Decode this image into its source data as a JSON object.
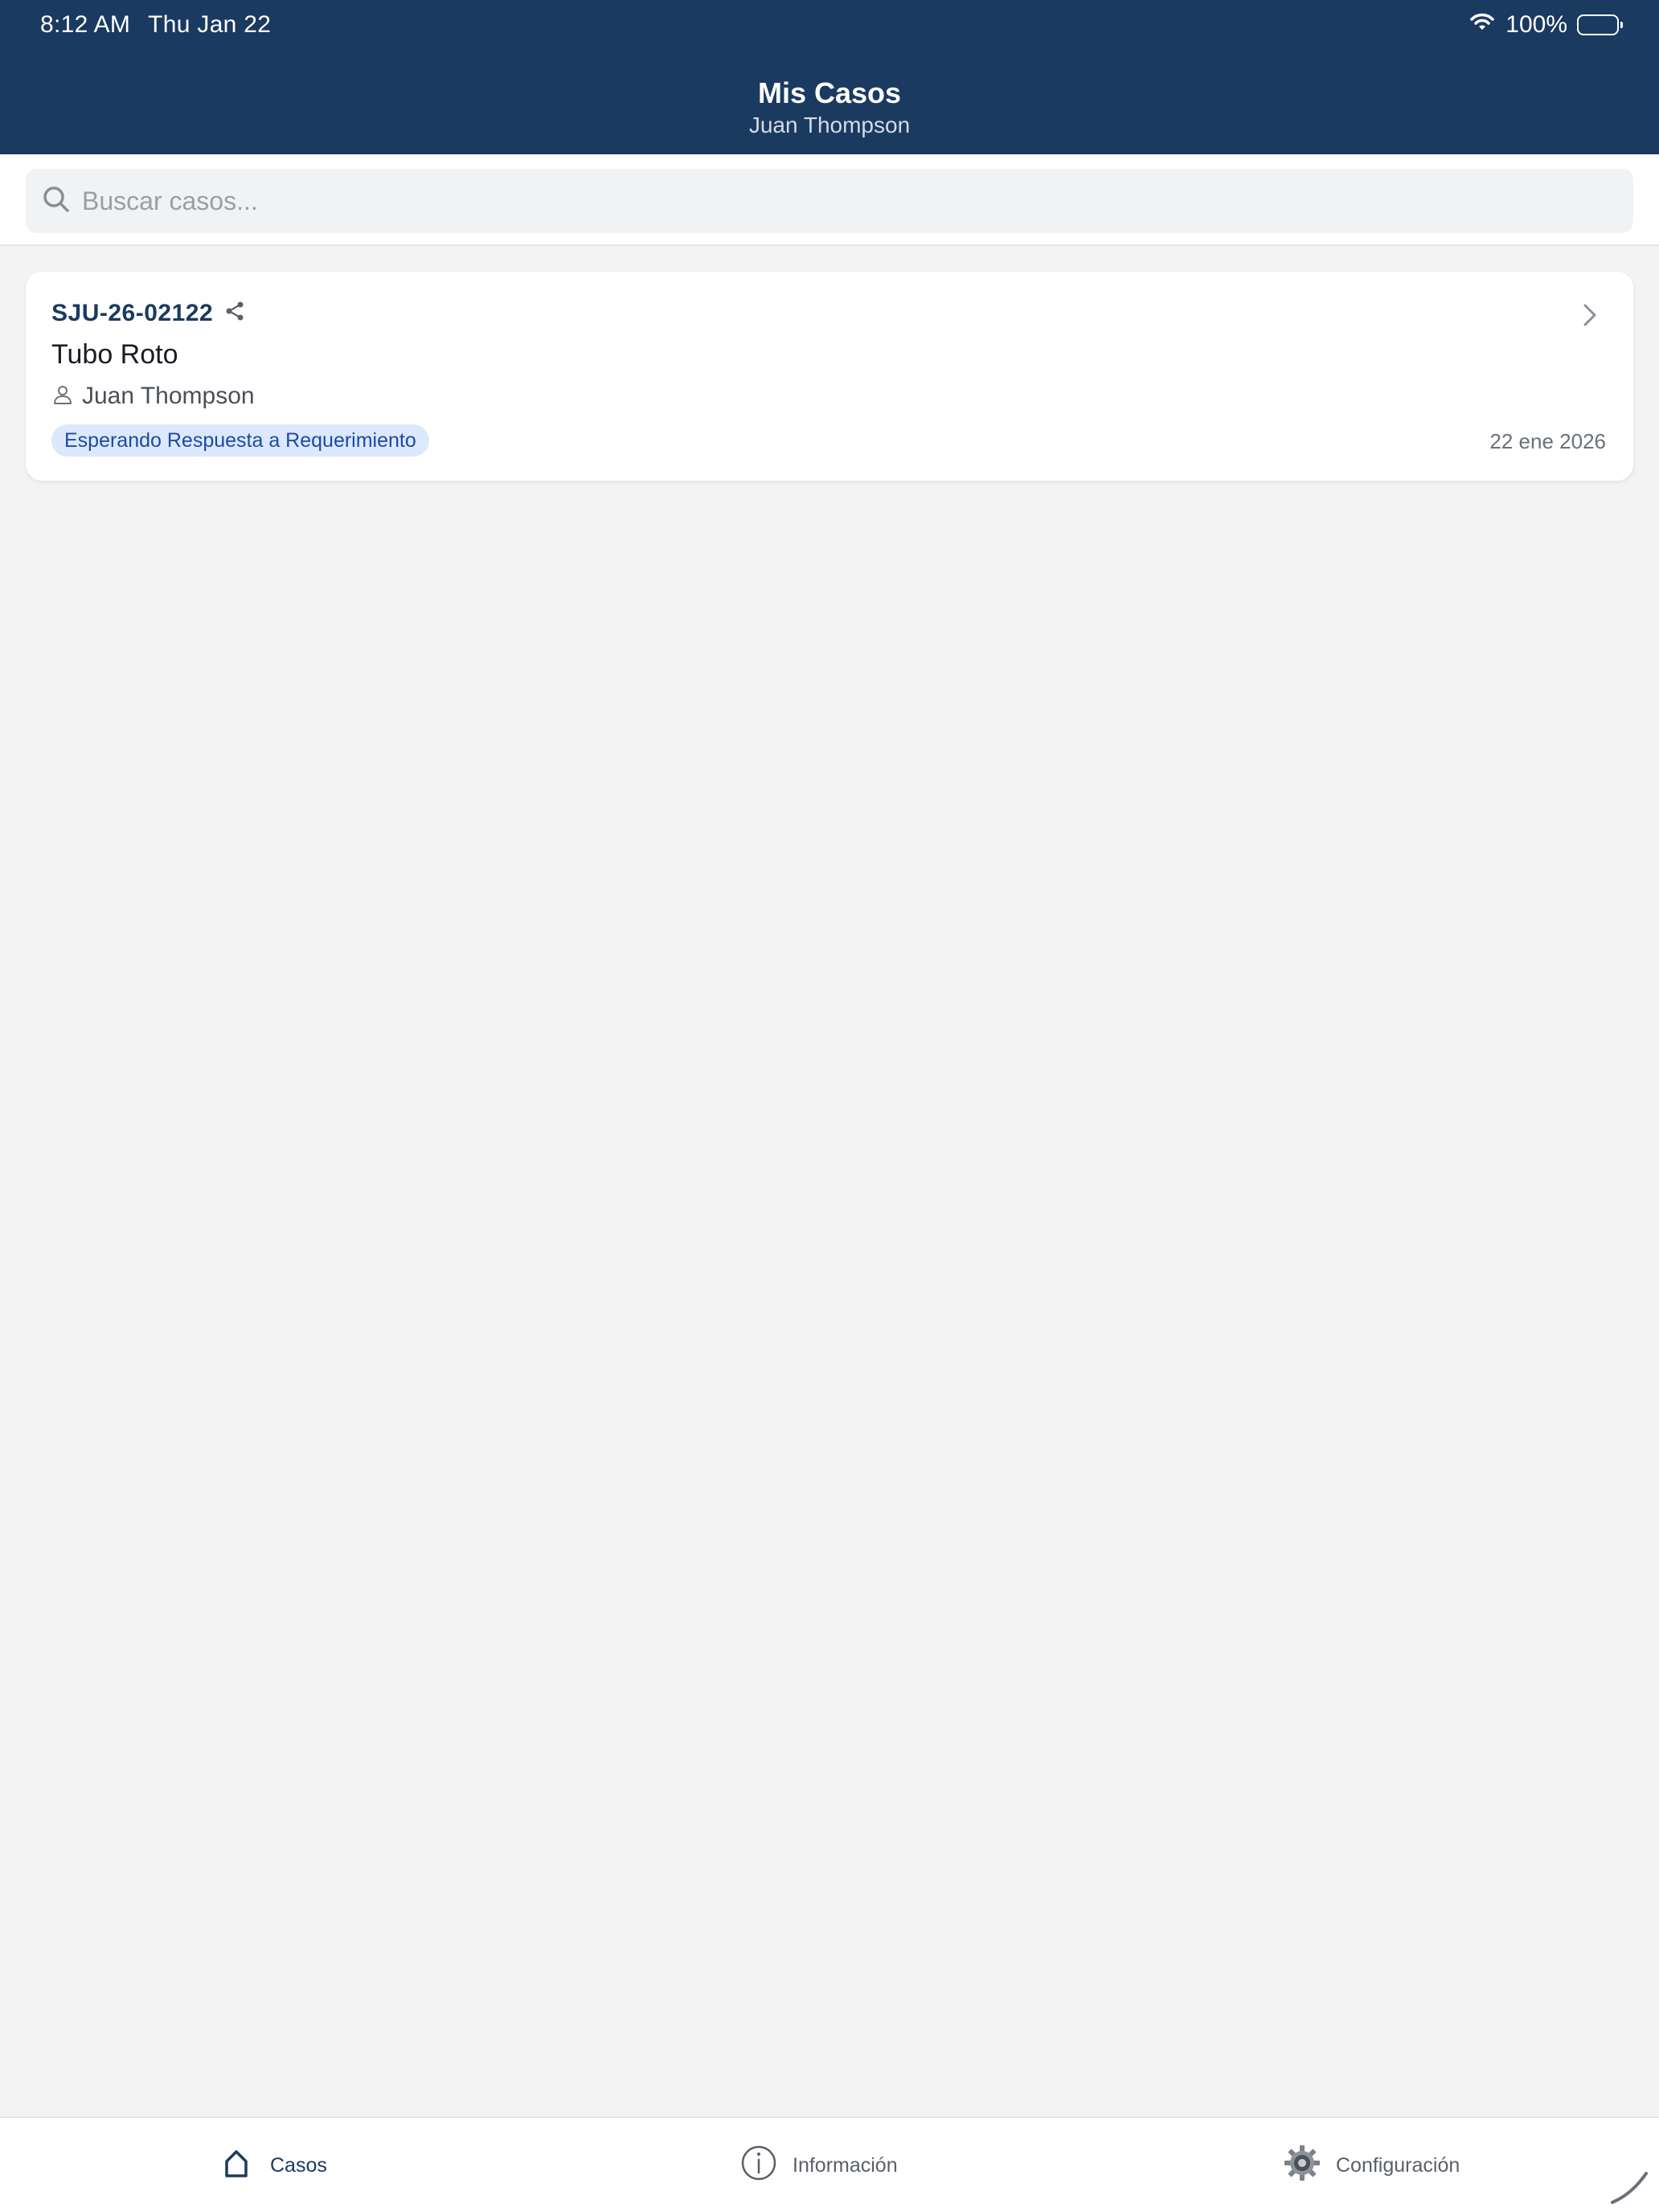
{
  "status_bar": {
    "time": "8:12 AM",
    "date": "Thu Jan 22",
    "battery": "100%",
    "wifi_icon": "wifi-icon",
    "battery_icon": "battery-icon"
  },
  "header": {
    "title": "Mis Casos",
    "subtitle": "Juan Thompson",
    "background": "#1b3a60"
  },
  "search": {
    "placeholder": "Buscar casos...",
    "value": "",
    "icon": "search-icon"
  },
  "cases": [
    {
      "id": "SJU-26-02122",
      "title": "Tubo Roto",
      "client": "Juan Thompson",
      "status": "Esperando Respuesta a Requerimiento",
      "date": "22 ene 2026",
      "status_color": "#dce8fb"
    }
  ],
  "tabs": [
    {
      "label": "Casos",
      "icon": "home-icon",
      "active": true
    },
    {
      "label": "Información",
      "icon": "info-icon",
      "active": false
    },
    {
      "label": "Configuración",
      "icon": "gear-icon",
      "active": false
    }
  ],
  "colors": {
    "accent": "#1b3a60",
    "badge_text": "#1d4aa6",
    "background": "#f3f3f4"
  }
}
